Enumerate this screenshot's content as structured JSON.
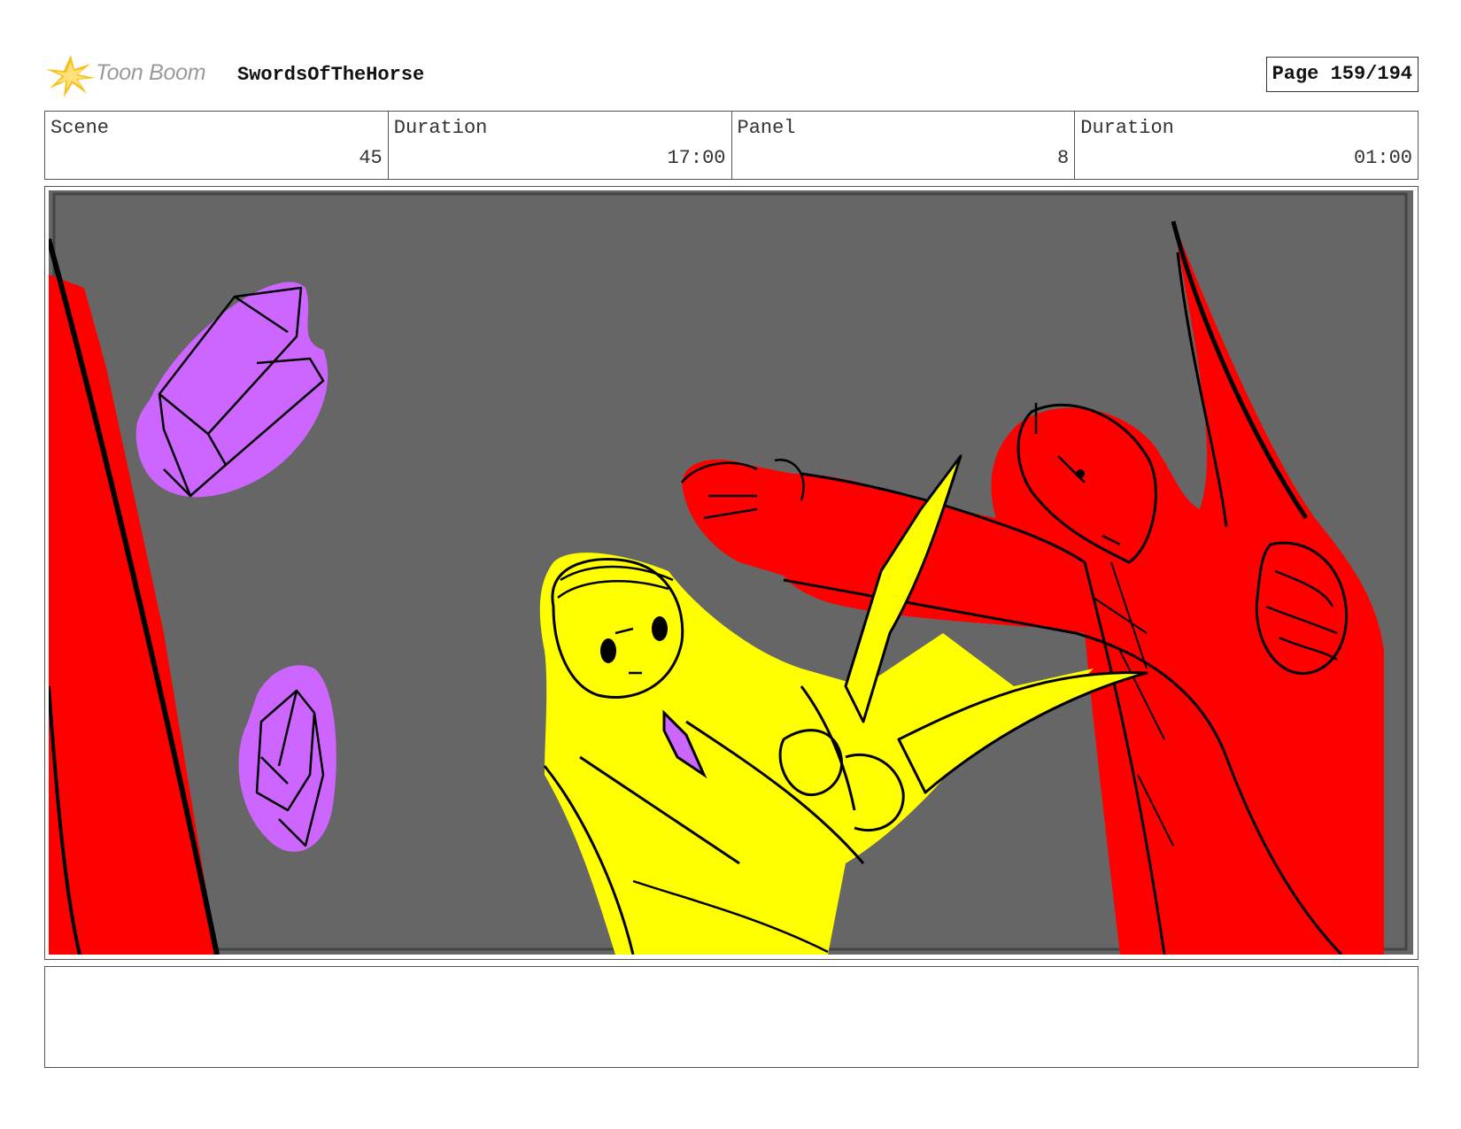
{
  "header": {
    "logo_text": "Toon Boom",
    "logo_icon": "starburst-logo-icon",
    "project_title": "SwordsOfTheHorse",
    "page_label": "Page 159/194"
  },
  "info": {
    "scene_label": "Scene",
    "scene_value": "45",
    "scene_duration_label": "Duration",
    "scene_duration_value": "17:00",
    "panel_label": "Panel",
    "panel_value": "8",
    "panel_duration_label": "Duration",
    "panel_duration_value": "01:00"
  },
  "panel": {
    "background_color": "#666666",
    "colors": {
      "red": "#ff0000",
      "yellow": "#ffff00",
      "purple": "#cc66ff",
      "ink": "#111111"
    }
  },
  "notes": {
    "text": ""
  }
}
